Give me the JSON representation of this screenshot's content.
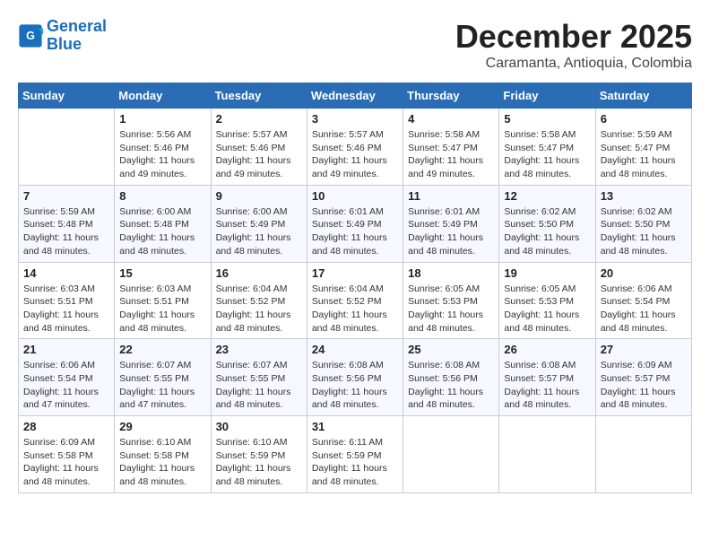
{
  "header": {
    "logo_line1": "General",
    "logo_line2": "Blue",
    "month_title": "December 2025",
    "location": "Caramanta, Antioquia, Colombia"
  },
  "days_of_week": [
    "Sunday",
    "Monday",
    "Tuesday",
    "Wednesday",
    "Thursday",
    "Friday",
    "Saturday"
  ],
  "weeks": [
    [
      {
        "day": "",
        "info": ""
      },
      {
        "day": "1",
        "info": "Sunrise: 5:56 AM\nSunset: 5:46 PM\nDaylight: 11 hours\nand 49 minutes."
      },
      {
        "day": "2",
        "info": "Sunrise: 5:57 AM\nSunset: 5:46 PM\nDaylight: 11 hours\nand 49 minutes."
      },
      {
        "day": "3",
        "info": "Sunrise: 5:57 AM\nSunset: 5:46 PM\nDaylight: 11 hours\nand 49 minutes."
      },
      {
        "day": "4",
        "info": "Sunrise: 5:58 AM\nSunset: 5:47 PM\nDaylight: 11 hours\nand 49 minutes."
      },
      {
        "day": "5",
        "info": "Sunrise: 5:58 AM\nSunset: 5:47 PM\nDaylight: 11 hours\nand 48 minutes."
      },
      {
        "day": "6",
        "info": "Sunrise: 5:59 AM\nSunset: 5:47 PM\nDaylight: 11 hours\nand 48 minutes."
      }
    ],
    [
      {
        "day": "7",
        "info": "Sunrise: 5:59 AM\nSunset: 5:48 PM\nDaylight: 11 hours\nand 48 minutes."
      },
      {
        "day": "8",
        "info": "Sunrise: 6:00 AM\nSunset: 5:48 PM\nDaylight: 11 hours\nand 48 minutes."
      },
      {
        "day": "9",
        "info": "Sunrise: 6:00 AM\nSunset: 5:49 PM\nDaylight: 11 hours\nand 48 minutes."
      },
      {
        "day": "10",
        "info": "Sunrise: 6:01 AM\nSunset: 5:49 PM\nDaylight: 11 hours\nand 48 minutes."
      },
      {
        "day": "11",
        "info": "Sunrise: 6:01 AM\nSunset: 5:49 PM\nDaylight: 11 hours\nand 48 minutes."
      },
      {
        "day": "12",
        "info": "Sunrise: 6:02 AM\nSunset: 5:50 PM\nDaylight: 11 hours\nand 48 minutes."
      },
      {
        "day": "13",
        "info": "Sunrise: 6:02 AM\nSunset: 5:50 PM\nDaylight: 11 hours\nand 48 minutes."
      }
    ],
    [
      {
        "day": "14",
        "info": "Sunrise: 6:03 AM\nSunset: 5:51 PM\nDaylight: 11 hours\nand 48 minutes."
      },
      {
        "day": "15",
        "info": "Sunrise: 6:03 AM\nSunset: 5:51 PM\nDaylight: 11 hours\nand 48 minutes."
      },
      {
        "day": "16",
        "info": "Sunrise: 6:04 AM\nSunset: 5:52 PM\nDaylight: 11 hours\nand 48 minutes."
      },
      {
        "day": "17",
        "info": "Sunrise: 6:04 AM\nSunset: 5:52 PM\nDaylight: 11 hours\nand 48 minutes."
      },
      {
        "day": "18",
        "info": "Sunrise: 6:05 AM\nSunset: 5:53 PM\nDaylight: 11 hours\nand 48 minutes."
      },
      {
        "day": "19",
        "info": "Sunrise: 6:05 AM\nSunset: 5:53 PM\nDaylight: 11 hours\nand 48 minutes."
      },
      {
        "day": "20",
        "info": "Sunrise: 6:06 AM\nSunset: 5:54 PM\nDaylight: 11 hours\nand 48 minutes."
      }
    ],
    [
      {
        "day": "21",
        "info": "Sunrise: 6:06 AM\nSunset: 5:54 PM\nDaylight: 11 hours\nand 47 minutes."
      },
      {
        "day": "22",
        "info": "Sunrise: 6:07 AM\nSunset: 5:55 PM\nDaylight: 11 hours\nand 47 minutes."
      },
      {
        "day": "23",
        "info": "Sunrise: 6:07 AM\nSunset: 5:55 PM\nDaylight: 11 hours\nand 48 minutes."
      },
      {
        "day": "24",
        "info": "Sunrise: 6:08 AM\nSunset: 5:56 PM\nDaylight: 11 hours\nand 48 minutes."
      },
      {
        "day": "25",
        "info": "Sunrise: 6:08 AM\nSunset: 5:56 PM\nDaylight: 11 hours\nand 48 minutes."
      },
      {
        "day": "26",
        "info": "Sunrise: 6:08 AM\nSunset: 5:57 PM\nDaylight: 11 hours\nand 48 minutes."
      },
      {
        "day": "27",
        "info": "Sunrise: 6:09 AM\nSunset: 5:57 PM\nDaylight: 11 hours\nand 48 minutes."
      }
    ],
    [
      {
        "day": "28",
        "info": "Sunrise: 6:09 AM\nSunset: 5:58 PM\nDaylight: 11 hours\nand 48 minutes."
      },
      {
        "day": "29",
        "info": "Sunrise: 6:10 AM\nSunset: 5:58 PM\nDaylight: 11 hours\nand 48 minutes."
      },
      {
        "day": "30",
        "info": "Sunrise: 6:10 AM\nSunset: 5:59 PM\nDaylight: 11 hours\nand 48 minutes."
      },
      {
        "day": "31",
        "info": "Sunrise: 6:11 AM\nSunset: 5:59 PM\nDaylight: 11 hours\nand 48 minutes."
      },
      {
        "day": "",
        "info": ""
      },
      {
        "day": "",
        "info": ""
      },
      {
        "day": "",
        "info": ""
      }
    ]
  ]
}
